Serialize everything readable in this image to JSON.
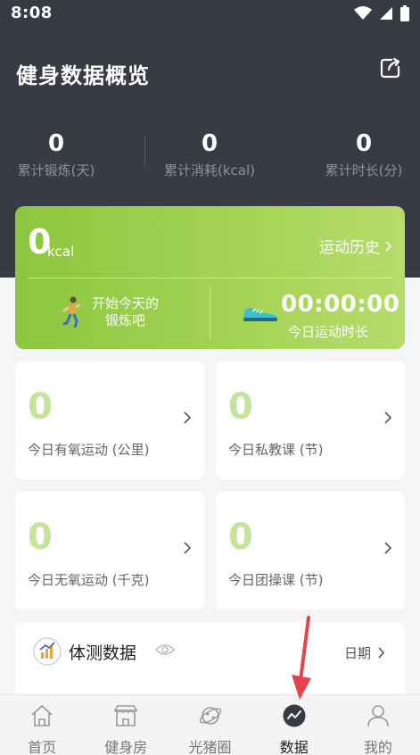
{
  "status_bar": {
    "time": "8:08"
  },
  "header": {
    "title": "健身数据概览"
  },
  "stats": [
    {
      "value": "0",
      "label": "累计锻炼(天)"
    },
    {
      "value": "0",
      "label": "累计消耗(kcal)"
    },
    {
      "value": "0",
      "label": "累计时长(分)"
    }
  ],
  "today_card": {
    "kcal_value": "0",
    "kcal_unit": "kcal",
    "history_label": "运动历史",
    "start_line1": "开始今天的",
    "start_line2": "锻炼吧",
    "timer": "00:00:00",
    "timer_label": "今日运动时长"
  },
  "metrics": [
    {
      "value": "0",
      "label": "今日有氧运动 (公里)"
    },
    {
      "value": "0",
      "label": "今日私教课 (节)"
    },
    {
      "value": "0",
      "label": "今日无氧运动 (千克)"
    },
    {
      "value": "0",
      "label": "今日团操课 (节)"
    }
  ],
  "body_test": {
    "title": "体测数据",
    "date_label": "日期"
  },
  "tabs": [
    {
      "label": "首页",
      "icon": "home-icon"
    },
    {
      "label": "健身房",
      "icon": "gym-store-icon"
    },
    {
      "label": "光猪圈",
      "icon": "planet-icon"
    },
    {
      "label": "数据",
      "icon": "data-chart-icon",
      "active": true
    },
    {
      "label": "我的",
      "icon": "user-icon"
    }
  ],
  "colors": {
    "accent": "#8cc63f",
    "header_bg": "#383a44",
    "pointer": "#e8424f"
  }
}
